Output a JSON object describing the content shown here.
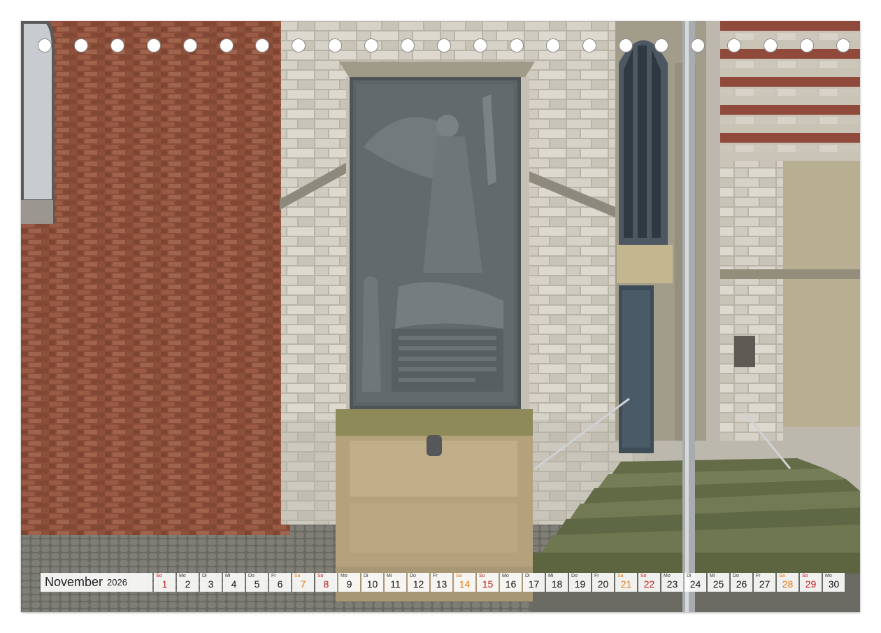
{
  "calendar": {
    "month": "November",
    "year": "2026",
    "colors": {
      "saturday": "#e07a10",
      "sunday": "#c01818",
      "cell_bg": "#ffffff"
    },
    "days": [
      {
        "wd": "So",
        "n": "1",
        "type": "sun"
      },
      {
        "wd": "Mo",
        "n": "2",
        "type": "wk"
      },
      {
        "wd": "Di",
        "n": "3",
        "type": "wk"
      },
      {
        "wd": "Mi",
        "n": "4",
        "type": "wk"
      },
      {
        "wd": "Do",
        "n": "5",
        "type": "wk"
      },
      {
        "wd": "Fr",
        "n": "6",
        "type": "wk"
      },
      {
        "wd": "Sa",
        "n": "7",
        "type": "sat"
      },
      {
        "wd": "So",
        "n": "8",
        "type": "sun"
      },
      {
        "wd": "Mo",
        "n": "9",
        "type": "wk"
      },
      {
        "wd": "Di",
        "n": "10",
        "type": "wk"
      },
      {
        "wd": "Mi",
        "n": "11",
        "type": "wk"
      },
      {
        "wd": "Do",
        "n": "12",
        "type": "wk"
      },
      {
        "wd": "Fr",
        "n": "13",
        "type": "wk"
      },
      {
        "wd": "Sa",
        "n": "14",
        "type": "sat"
      },
      {
        "wd": "So",
        "n": "15",
        "type": "sun"
      },
      {
        "wd": "Mo",
        "n": "16",
        "type": "wk"
      },
      {
        "wd": "Di",
        "n": "17",
        "type": "wk"
      },
      {
        "wd": "Mi",
        "n": "18",
        "type": "wk"
      },
      {
        "wd": "Do",
        "n": "19",
        "type": "wk"
      },
      {
        "wd": "Fr",
        "n": "20",
        "type": "wk"
      },
      {
        "wd": "Sa",
        "n": "21",
        "type": "sat"
      },
      {
        "wd": "So",
        "n": "22",
        "type": "sun"
      },
      {
        "wd": "Mo",
        "n": "23",
        "type": "wk"
      },
      {
        "wd": "Di",
        "n": "24",
        "type": "wk"
      },
      {
        "wd": "Mi",
        "n": "25",
        "type": "wk"
      },
      {
        "wd": "Do",
        "n": "26",
        "type": "wk"
      },
      {
        "wd": "Fr",
        "n": "27",
        "type": "wk"
      },
      {
        "wd": "Sa",
        "n": "28",
        "type": "sat"
      },
      {
        "wd": "So",
        "n": "29",
        "type": "sun"
      },
      {
        "wd": "Mo",
        "n": "30",
        "type": "wk"
      }
    ]
  },
  "binding": {
    "hole_count": 23
  }
}
